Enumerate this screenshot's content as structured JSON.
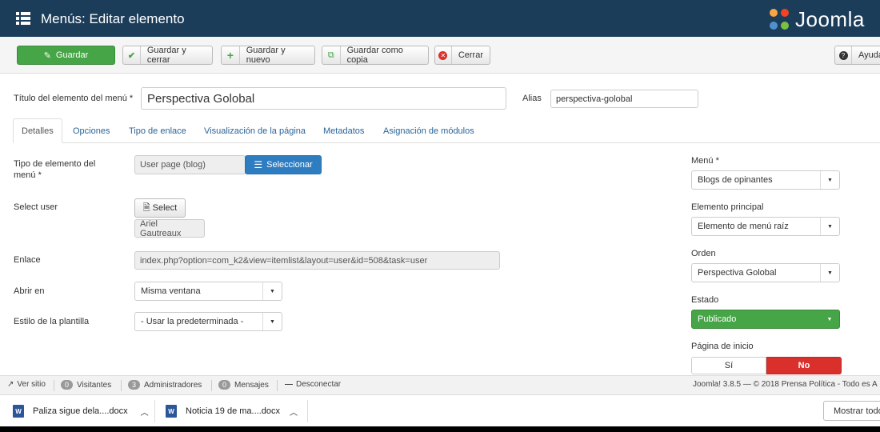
{
  "header": {
    "title": "Menús: Editar elemento",
    "logo_text": "Joomla"
  },
  "toolbar": {
    "save": "Guardar",
    "save_close": "Guardar y cerrar",
    "save_new": "Guardar y nuevo",
    "save_copy": "Guardar como copia",
    "close": "Cerrar",
    "help": "Ayuda"
  },
  "form": {
    "title_label": "Título del elemento del menú *",
    "title_value": "Perspectiva Golobal",
    "alias_label": "Alias",
    "alias_value": "perspectiva-golobal"
  },
  "tabs": [
    "Detalles",
    "Opciones",
    "Tipo de enlace",
    "Visualización de la página",
    "Metadatos",
    "Asignación de módulos"
  ],
  "details": {
    "type_label_1": "Tipo de elemento del",
    "type_label_2": "menú *",
    "type_value": "User page (blog)",
    "select_button": "Seleccionar",
    "user_label": "Select user",
    "user_select_button": "Select",
    "user_value": "Ariel Gautreaux",
    "link_label": "Enlace",
    "link_value": "index.php?option=com_k2&view=itemlist&layout=user&id=508&task=user",
    "open_label": "Abrir en",
    "open_value": "Misma ventana",
    "template_label": "Estilo de la plantilla",
    "template_value": "- Usar la predeterminada -"
  },
  "side": {
    "menu_label": "Menú *",
    "menu_value": "Blogs de opinantes",
    "parent_label": "Elemento principal",
    "parent_value": "Elemento de menú raíz",
    "order_label": "Orden",
    "order_value": "Perspectiva Golobal",
    "status_label": "Estado",
    "status_value": "Publicado",
    "home_label": "Página de inicio",
    "home_yes": "Sí",
    "home_no": "No"
  },
  "statusbar": {
    "view_site": "Ver sitio",
    "visitors_count": "0",
    "visitors": "Visitantes",
    "admins_count": "3",
    "admins": "Administradores",
    "messages_count": "0",
    "messages": "Mensajes",
    "logout": "Desconectar",
    "footer": "Joomla! 3.8.5 — © 2018 Prensa Política - Todo es A"
  },
  "downloads": {
    "file1": "Paliza sigue dela....docx",
    "file2": "Noticia 19 de ma....docx",
    "show_all": "Mostrar todo"
  },
  "colors": {
    "header": "#1c3d5a",
    "green": "#46a546",
    "blue": "#2f7dc1",
    "red": "#d9302c"
  }
}
